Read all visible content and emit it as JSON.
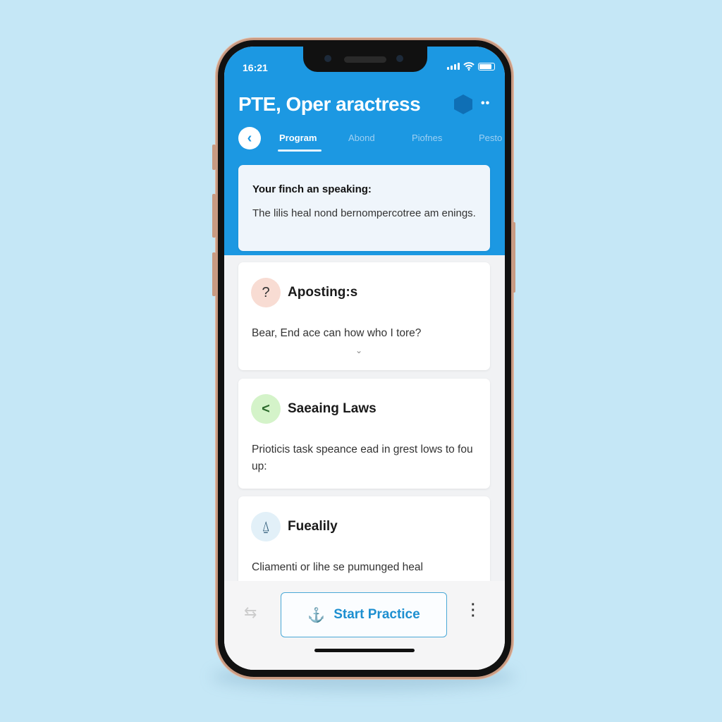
{
  "status_bar": {
    "time": "16:21"
  },
  "header": {
    "title": "PTE, Oper aractress",
    "tabs": [
      {
        "label": "Program",
        "active": true
      },
      {
        "label": "Abond"
      },
      {
        "label": "Piofnes"
      },
      {
        "label": "Pesto"
      }
    ]
  },
  "intro": {
    "heading": "Your finch an speaking:",
    "text": "The lilis heal nond bernompercotree am enings."
  },
  "cards": [
    {
      "icon": "question-icon",
      "icon_glyph": "?",
      "title": "Aposting:s",
      "text": "Bear, End ace can how who I tore?"
    },
    {
      "icon": "share-icon",
      "icon_glyph": "<",
      "title": "Saeaing Laws",
      "text": "Prioticis task speance ead in grest lows to fou up:"
    },
    {
      "icon": "person-icon",
      "icon_glyph": "⍙",
      "title": "Fuealily",
      "text": "Cliamenti or lihe se pumunged heal"
    }
  ],
  "bottom_bar": {
    "start_label": "Start Practice"
  },
  "colors": {
    "accent": "#1c98e2",
    "background": "#c5e7f6"
  }
}
